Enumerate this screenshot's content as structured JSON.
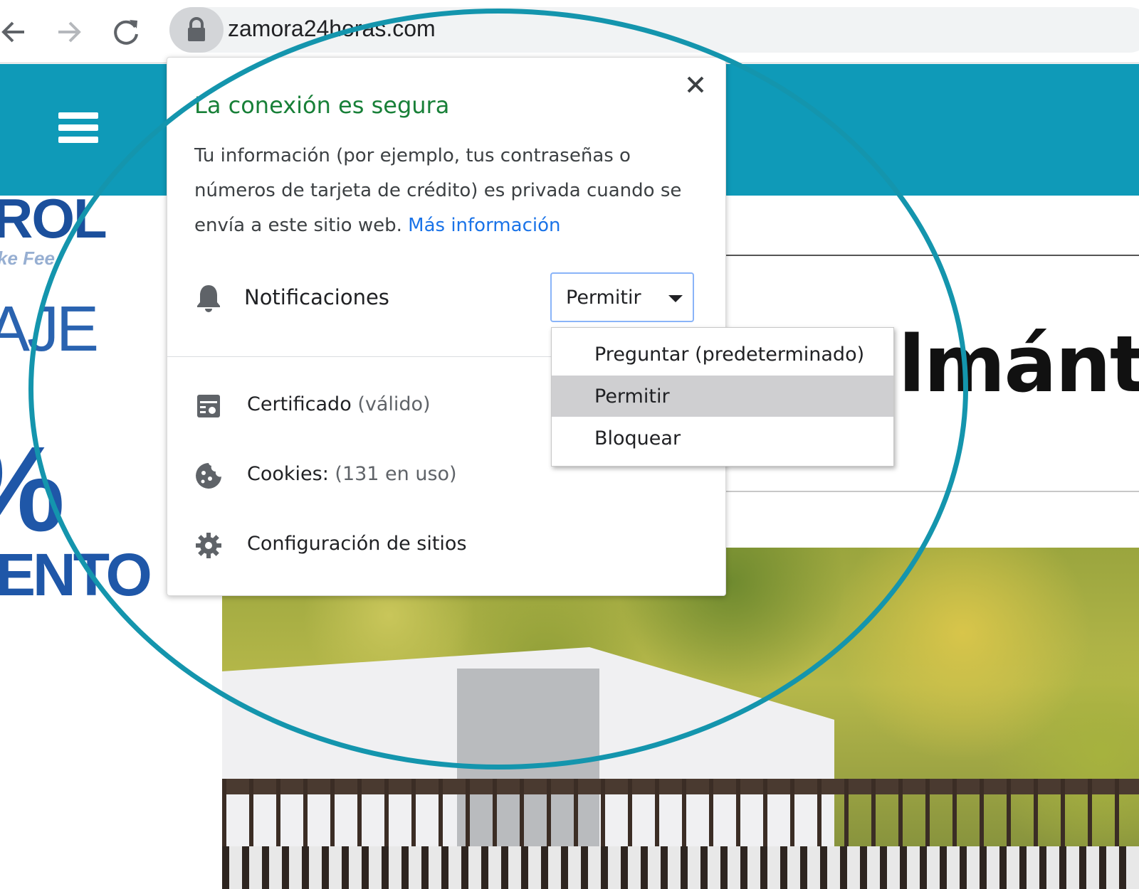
{
  "browser": {
    "url": "zamora24horas.com",
    "icons": {
      "back": "arrow-left-icon",
      "forward": "arrow-right-icon",
      "reload": "reload-icon",
      "lock": "lock-icon"
    }
  },
  "website": {
    "header_color": "#0f9ab8",
    "logo_text": "ROL",
    "logo_tagline": "ke Fee",
    "promo_word": "AJE",
    "promo_percent": "%",
    "promo_word2": "ENTO",
    "headline": "lmánt"
  },
  "site_info": {
    "title": "La conexión es segura",
    "description": "Tu información (por ejemplo, tus contraseñas o números de tarjeta de crédito) es privada cuando se envía a este sitio web.",
    "link_text": "Más información",
    "notifications": {
      "label": "Notificaciones",
      "selected_value": "Permitir",
      "icon": "bell-icon"
    },
    "certificate": {
      "label": "Certificado",
      "status": "(válido)",
      "icon": "certificate-icon"
    },
    "cookies": {
      "label": "Cookies:",
      "status": "(131 en uso)",
      "icon": "cookie-icon"
    },
    "site_settings": {
      "label": "Configuración de sitios",
      "icon": "gear-icon"
    },
    "colors": {
      "secure_green": "#188038",
      "link_blue": "#1a73e8"
    }
  },
  "dropdown": {
    "options": [
      "Preguntar (predeterminado)",
      "Permitir",
      "Bloquear"
    ],
    "selected": "Permitir"
  },
  "annotation": {
    "circle_color": "#1495ad"
  }
}
